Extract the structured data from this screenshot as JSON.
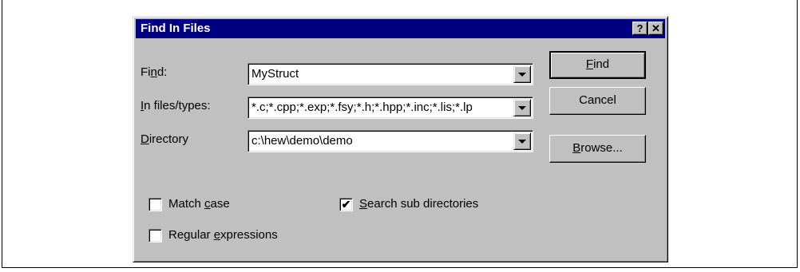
{
  "dialog": {
    "title": "Find In Files",
    "help_button": "?",
    "close_button": "✕"
  },
  "fields": {
    "find": {
      "label_pre": "Fi",
      "label_u": "n",
      "label_post": "d:",
      "value": "MyStruct"
    },
    "files": {
      "label_pre": "",
      "label_u": "I",
      "label_post": "n files/types:",
      "value": "*.c;*.cpp;*.exp;*.fsy;*.h;*.hpp;*.inc;*.lis;*.lp"
    },
    "directory": {
      "label_pre": "",
      "label_u": "D",
      "label_post": "irectory",
      "value": "c:\\hew\\demo\\demo"
    }
  },
  "buttons": {
    "find": {
      "pre": "",
      "u": "F",
      "post": "ind"
    },
    "cancel": {
      "label": "Cancel"
    },
    "browse": {
      "pre": "",
      "u": "B",
      "post": "rowse..."
    }
  },
  "options": {
    "match_case": {
      "pre": "Match ",
      "u": "c",
      "post": "ase",
      "checked": false
    },
    "regex": {
      "pre": "Regular ",
      "u": "e",
      "post": "xpressions",
      "checked": false
    },
    "subdirs": {
      "pre": "",
      "u": "S",
      "post": "earch sub directories",
      "checked": true,
      "mark": "✔"
    }
  }
}
